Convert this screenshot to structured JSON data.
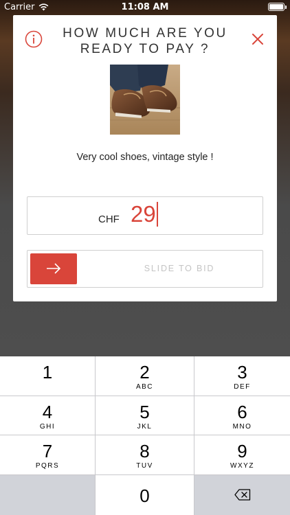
{
  "status_bar": {
    "carrier": "Carrier",
    "time": "11:08 AM"
  },
  "modal": {
    "title": "HOW MUCH ARE YOU READY TO PAY ?",
    "description": "Very cool shoes, vintage style !",
    "bid": {
      "currency": "CHF",
      "amount": "29"
    },
    "slider": {
      "label": "SLIDE TO BID"
    },
    "accent_color": "#d9453a"
  },
  "keypad": {
    "keys": [
      {
        "num": "1",
        "letters": ""
      },
      {
        "num": "2",
        "letters": "ABC"
      },
      {
        "num": "3",
        "letters": "DEF"
      },
      {
        "num": "4",
        "letters": "GHI"
      },
      {
        "num": "5",
        "letters": "JKL"
      },
      {
        "num": "6",
        "letters": "MNO"
      },
      {
        "num": "7",
        "letters": "PQRS"
      },
      {
        "num": "8",
        "letters": "TUV"
      },
      {
        "num": "9",
        "letters": "WXYZ"
      },
      {
        "num": "0",
        "letters": ""
      }
    ]
  }
}
